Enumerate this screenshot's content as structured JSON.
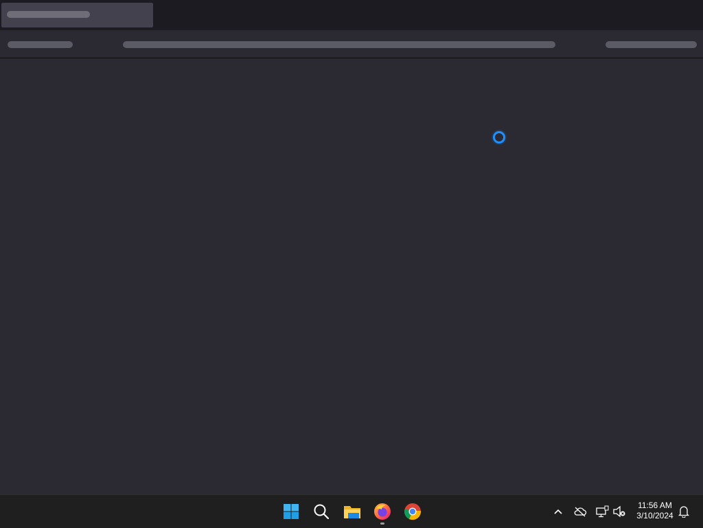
{
  "taskbar": {
    "icons": {
      "start": "windows-start-icon",
      "search": "search-icon",
      "file_explorer": "file-explorer-icon",
      "firefox": "firefox-icon",
      "chrome": "chrome-icon"
    },
    "tray": {
      "overflow": "chevron-up-icon",
      "onedrive": "cloud-offline-icon",
      "network": "network-disconnected-icon",
      "volume": "volume-muted-icon",
      "notifications": "bell-icon"
    },
    "clock": {
      "time": "11:56 AM",
      "date": "3/10/2024"
    }
  },
  "colors": {
    "page_background": "#2b2a33",
    "titlebar": "#1c1b22",
    "spinner": "#1e90ff"
  }
}
